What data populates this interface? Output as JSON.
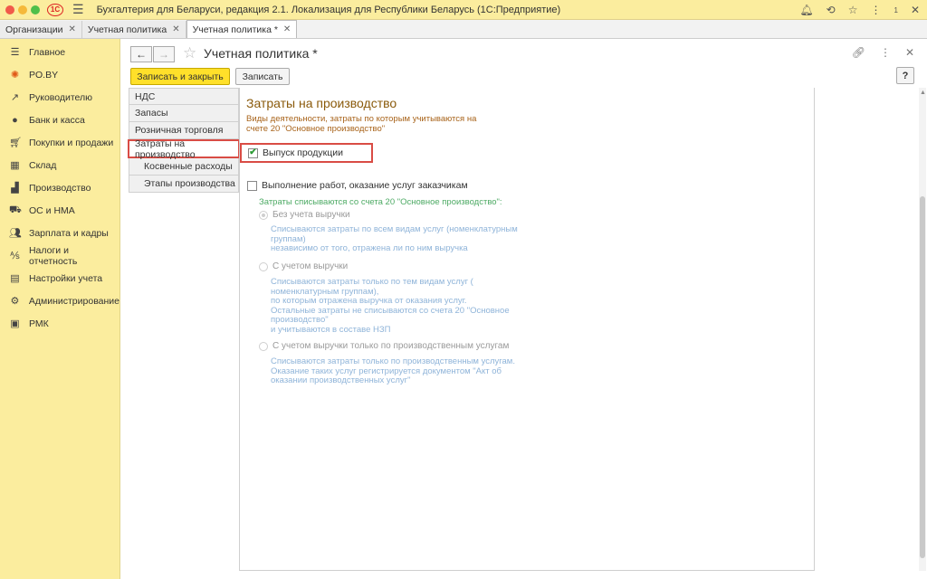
{
  "titlebar": {
    "logo": "1С",
    "title": "Бухгалтерия для Беларуси, редакция 2.1. Локализация для Республики Беларусь   (1С:Предприятие)",
    "notif_count": "1"
  },
  "tabs": [
    {
      "label": "Организации",
      "active": false
    },
    {
      "label": "Учетная политика",
      "active": false
    },
    {
      "label": "Учетная политика *",
      "active": true
    }
  ],
  "sidebar": {
    "items": [
      {
        "label": "Главное",
        "icon": "menu-icon"
      },
      {
        "label": "PO.BY",
        "icon": "sun-icon"
      },
      {
        "label": "Руководителю",
        "icon": "trend-icon"
      },
      {
        "label": "Банк и касса",
        "icon": "coin-icon"
      },
      {
        "label": "Покупки и продажи",
        "icon": "cart-icon"
      },
      {
        "label": "Склад",
        "icon": "warehouse-icon"
      },
      {
        "label": "Производство",
        "icon": "factory-icon"
      },
      {
        "label": "ОС и НМА",
        "icon": "truck-icon"
      },
      {
        "label": "Зарплата и кадры",
        "icon": "people-icon"
      },
      {
        "label": "Налоги и отчетность",
        "icon": "tax-icon"
      },
      {
        "label": "Настройки учета",
        "icon": "settings-doc-icon"
      },
      {
        "label": "Администрирование",
        "icon": "gear-icon"
      },
      {
        "label": "РМК",
        "icon": "register-icon"
      }
    ]
  },
  "header": {
    "title": "Учетная политика *",
    "save_close": "Записать и закрыть",
    "save": "Записать",
    "help": "?"
  },
  "sections": [
    {
      "label": "НДС",
      "sub": false,
      "selected": false
    },
    {
      "label": "Запасы",
      "sub": false,
      "selected": false
    },
    {
      "label": "Розничная торговля",
      "sub": false,
      "selected": false
    },
    {
      "label": "Затраты на производство",
      "sub": false,
      "selected": true
    },
    {
      "label": "Косвенные расходы",
      "sub": true,
      "selected": false
    },
    {
      "label": "Этапы производства",
      "sub": true,
      "selected": false
    }
  ],
  "content": {
    "title": "Затраты на производство",
    "desc": "Виды деятельности, затраты по которым учитываются на счете 20 \"Основное производство\"",
    "chk_products": {
      "label": "Выпуск продукции",
      "checked": true
    },
    "chk_services": {
      "label": "Выполнение работ, оказание услуг заказчикам",
      "checked": false
    },
    "green_note": "Затраты списываются со счета 20 \"Основное производство\":",
    "radio1": {
      "label": "Без учета выручки",
      "hint": [
        "Списываются затраты по всем видам услуг (номенклатурным",
        "группам)",
        "независимо от того, отражена ли по ним выручка"
      ]
    },
    "radio2": {
      "label": "С учетом выручки",
      "hint": [
        "Списываются затраты только по тем видам услуг (",
        "номенклатурным группам),",
        "по которым отражена выручка от оказания услуг.",
        "Остальные затраты не списываются со счета 20 \"Основное",
        "производство\"",
        "и учитываются в составе НЗП"
      ]
    },
    "radio3": {
      "label": "С учетом выручки только по производственным услугам",
      "hint": [
        "Списываются затраты только по производственным услугам.",
        "Оказание таких услуг регистрируется документом \"Акт об",
        "оказании производственных услуг\""
      ]
    }
  }
}
